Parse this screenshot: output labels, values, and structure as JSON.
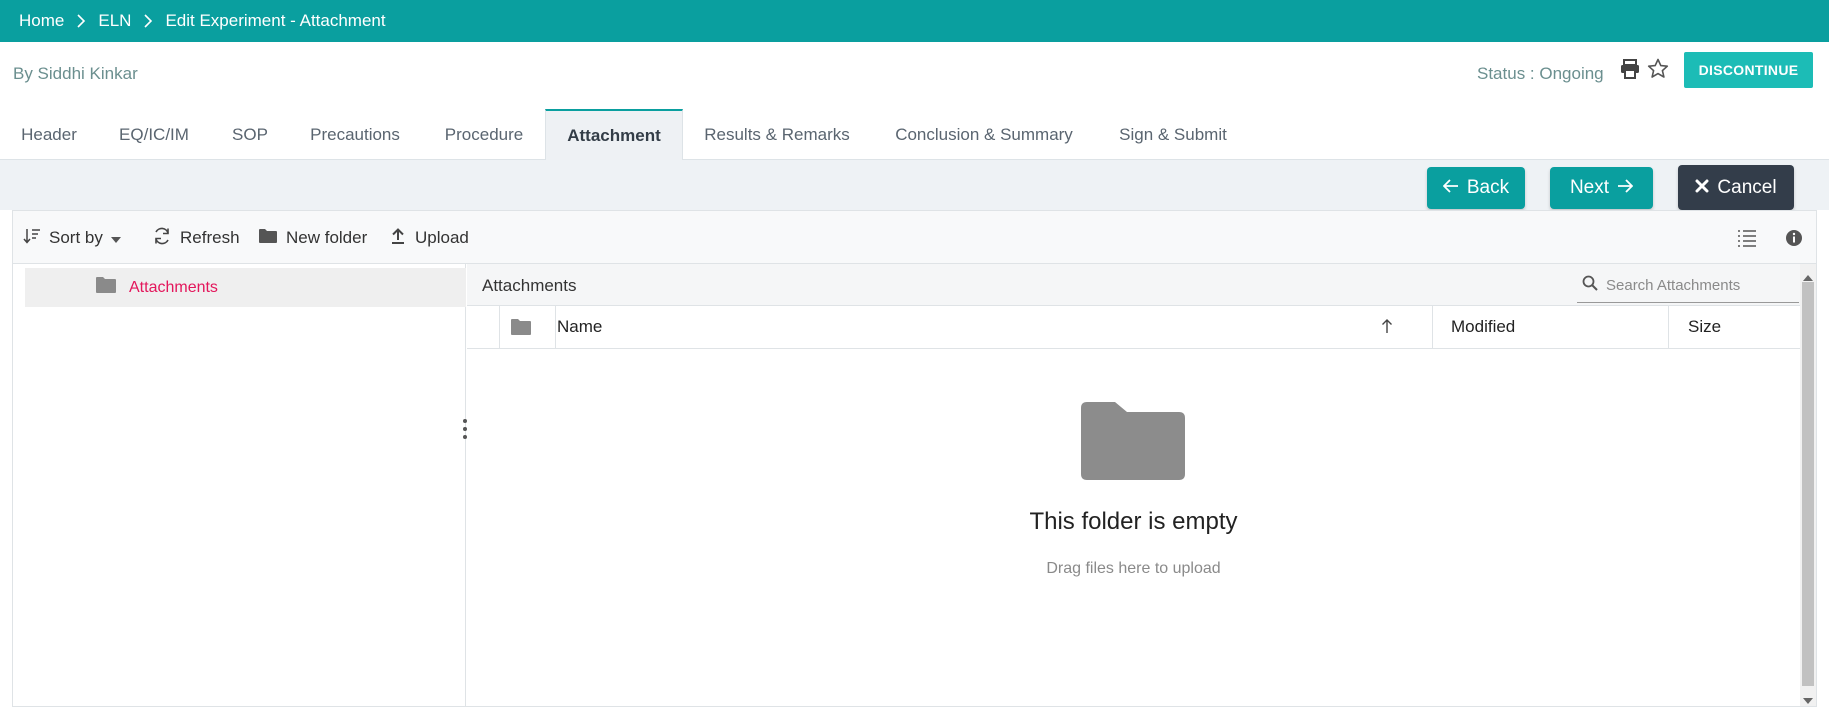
{
  "breadcrumb": {
    "home": "Home",
    "eln": "ELN",
    "current": "Edit Experiment - Attachment"
  },
  "header": {
    "author": "By Siddhi Kinkar",
    "status": "Status : Ongoing",
    "discontinue_label": "DISCONTINUE"
  },
  "tabs": [
    "Header",
    "EQ/IC/IM",
    "SOP",
    "Precautions",
    "Procedure",
    "Attachment",
    "Results & Remarks",
    "Conclusion & Summary",
    "Sign & Submit"
  ],
  "active_tab": "Attachment",
  "actions": {
    "back": "Back",
    "next": "Next",
    "cancel": "Cancel"
  },
  "toolbar": {
    "sort_by": "Sort by",
    "refresh": "Refresh",
    "new_folder": "New folder",
    "upload": "Upload"
  },
  "tree": {
    "root": "Attachments"
  },
  "path": {
    "current": "Attachments"
  },
  "search": {
    "placeholder": "Search Attachments"
  },
  "grid": {
    "columns": {
      "name": "Name",
      "modified": "Modified",
      "size": "Size"
    }
  },
  "empty": {
    "title": "This folder is empty",
    "subtitle": "Drag files here to upload"
  },
  "colors": {
    "primary": "#0a9f9f",
    "accent_button": "#1cbcb6",
    "cancel_button": "#333d4a",
    "selected_text": "#e3165b"
  },
  "icons": [
    "chevron-right-icon",
    "print-icon",
    "star-icon",
    "arrow-left-icon",
    "arrow-right-icon",
    "close-icon",
    "sort-icon",
    "caret-down-icon",
    "refresh-icon",
    "folder-icon",
    "upload-icon",
    "list-view-icon",
    "info-icon",
    "search-icon",
    "sort-ascending-icon",
    "splitter-handle-icon"
  ]
}
